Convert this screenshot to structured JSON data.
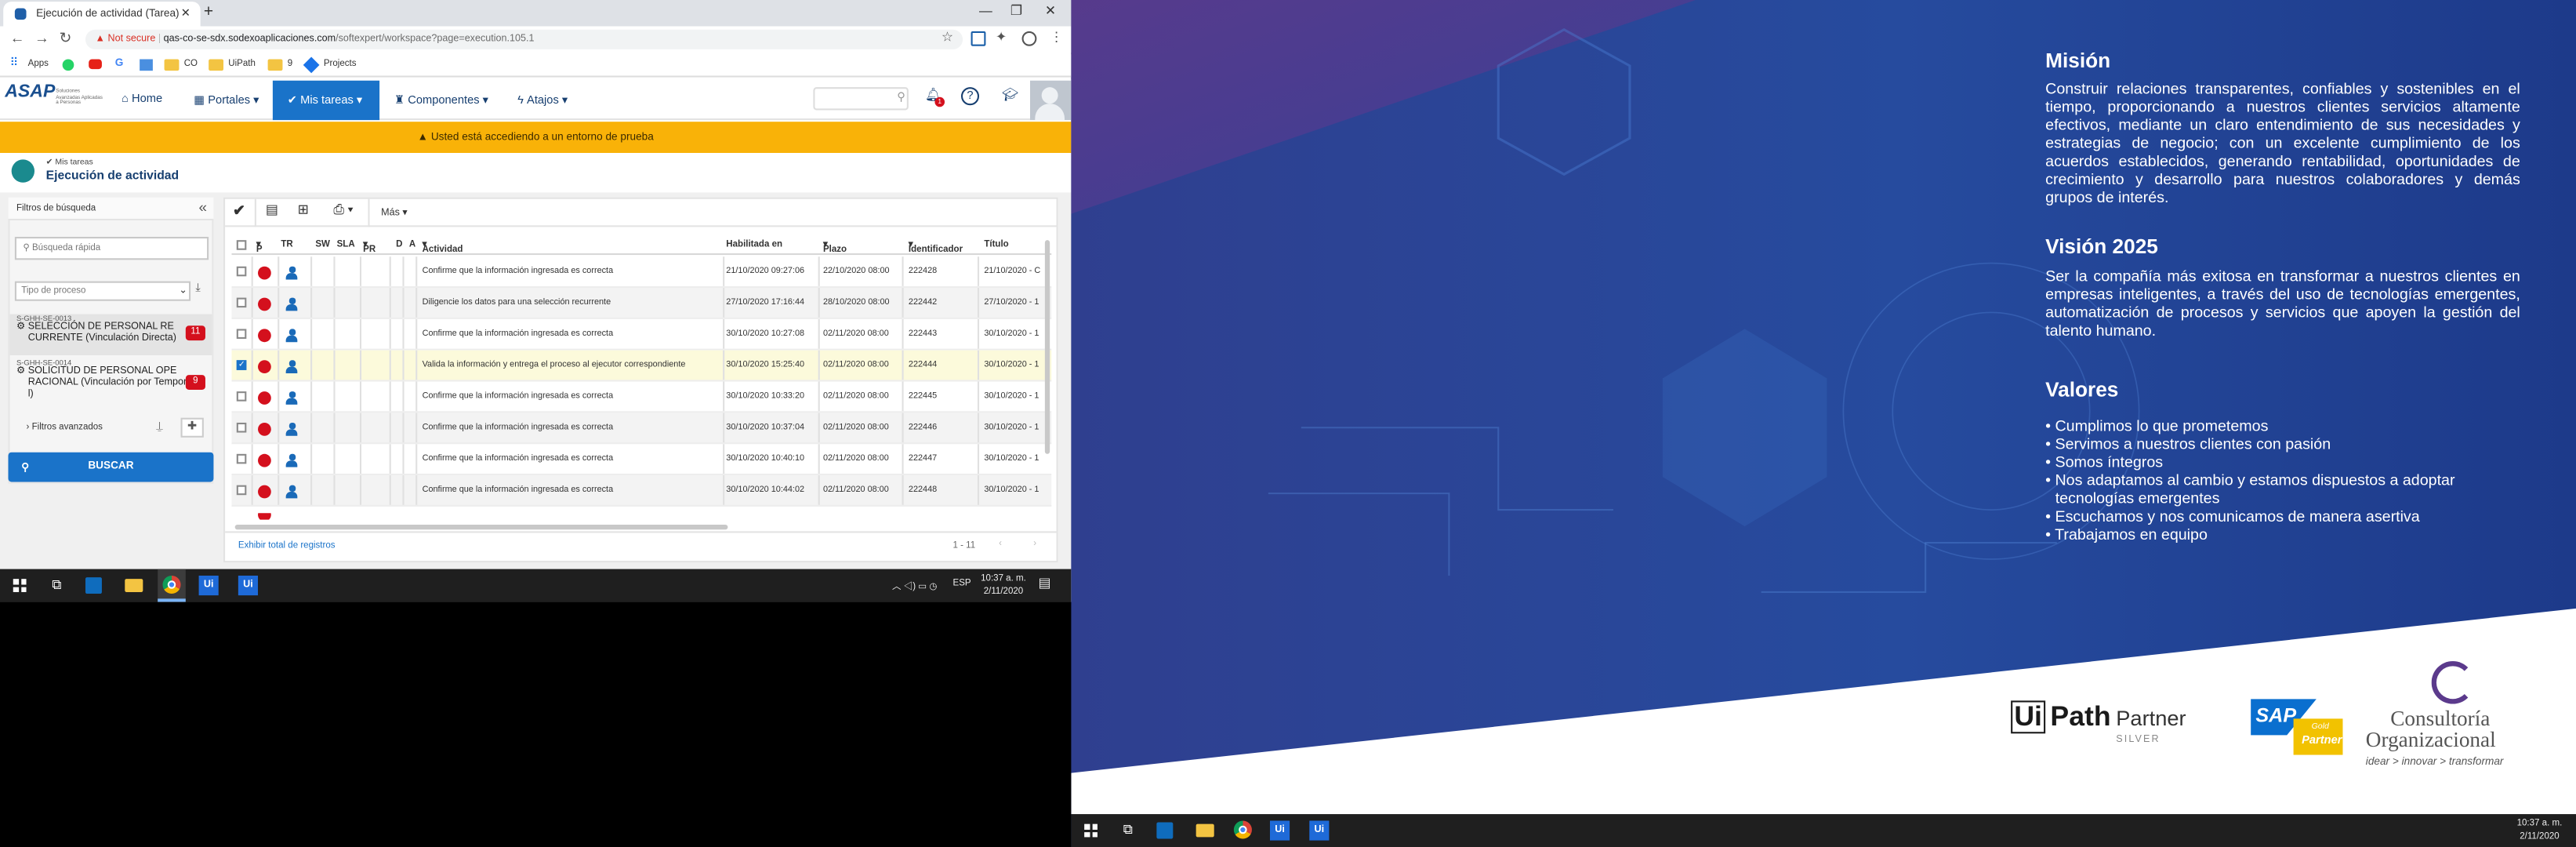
{
  "browser": {
    "tab_title": "Ejecución de actividad (Tarea)",
    "warning": "Not secure",
    "url_host": "qas-co-se-sdx.sodexoaplicaciones.com",
    "url_path": "/softexpert/workspace?page=execution.105.1",
    "bookmarks": [
      "Apps",
      "CO",
      "UiPath",
      "9",
      "Projects"
    ]
  },
  "header": {
    "logo": "ASAP",
    "logo_sub": "Soluciones Avanzadas Aplicadas a Personas",
    "menu": [
      "Home",
      "Portales",
      "Mis tareas",
      "Componentes",
      "Atajos"
    ],
    "notif_count": "1"
  },
  "banner": "Usted está accediendo a un entorno de prueba",
  "breadcrumb": {
    "parent": "Mis tareas",
    "title": "Ejecución de actividad"
  },
  "filters": {
    "title": "Filtros de búsqueda",
    "quick_placeholder": "Búsqueda rápida",
    "process_type": "Tipo de proceso",
    "items": [
      {
        "code": "S-GHH-SE-0013",
        "label": "SELECCIÓN DE PERSONAL RE CURRENTE (Vinculación Directa)",
        "count": "11"
      },
      {
        "code": "S-GHH-SE-0014",
        "label": "SOLICITUD DE PERSONAL OPE RACIONAL (Vinculación por Tempora l)",
        "count": "9"
      }
    ],
    "advanced": "Filtros avanzados",
    "search_button": "BUSCAR"
  },
  "toolbar": {
    "more": "Más"
  },
  "table": {
    "headers": [
      "P",
      "TR",
      "SW",
      "SLA",
      "PR",
      "D",
      "A",
      "Actividad",
      "Habilitada en",
      "Plazo",
      "Identificador",
      "Título"
    ],
    "rows": [
      {
        "actividad": "Confirme que la información ingresada es correcta",
        "habilitada": "21/10/2020 09:27:06",
        "plazo": "22/10/2020 08:00",
        "id": "222428",
        "titulo": "21/10/2020 - C",
        "checked": false
      },
      {
        "actividad": "Diligencie los datos para una selección recurrente",
        "habilitada": "27/10/2020 17:16:44",
        "plazo": "28/10/2020 08:00",
        "id": "222442",
        "titulo": "27/10/2020 - 1",
        "checked": false
      },
      {
        "actividad": "Confirme que la información ingresada es correcta",
        "habilitada": "30/10/2020 10:27:08",
        "plazo": "02/11/2020 08:00",
        "id": "222443",
        "titulo": "30/10/2020 - 1",
        "checked": false
      },
      {
        "actividad": "Valida la información y entrega el proceso al ejecutor correspondiente",
        "habilitada": "30/10/2020 15:25:40",
        "plazo": "02/11/2020 08:00",
        "id": "222444",
        "titulo": "30/10/2020 - 1",
        "checked": true
      },
      {
        "actividad": "Confirme que la información ingresada es correcta",
        "habilitada": "30/10/2020 10:33:20",
        "plazo": "02/11/2020 08:00",
        "id": "222445",
        "titulo": "30/10/2020 - 1",
        "checked": false
      },
      {
        "actividad": "Confirme que la información ingresada es correcta",
        "habilitada": "30/10/2020 10:37:04",
        "plazo": "02/11/2020 08:00",
        "id": "222446",
        "titulo": "30/10/2020 - 1",
        "checked": false
      },
      {
        "actividad": "Confirme que la información ingresada es correcta",
        "habilitada": "30/10/2020 10:40:10",
        "plazo": "02/11/2020 08:00",
        "id": "222447",
        "titulo": "30/10/2020 - 1",
        "checked": false
      },
      {
        "actividad": "Confirme que la información ingresada es correcta",
        "habilitada": "30/10/2020 10:44:02",
        "plazo": "02/11/2020 08:00",
        "id": "222448",
        "titulo": "30/10/2020 - 1",
        "checked": false
      }
    ],
    "footer_link": "Exhibir total de registros",
    "pagination": "1 - 11"
  },
  "taskbar": {
    "lang": "ESP",
    "time": "10:37 a. m.",
    "date": "2/11/2020"
  },
  "slide": {
    "mision_title": "Misión",
    "mision_text": "Construir relaciones transparentes, confiables y sostenibles en el tiempo, proporcionando a nuestros clientes servicios altamente efectivos, mediante un claro entendimiento de sus necesidades y estrategias de negocio; con un excelente cumplimiento de los acuerdos establecidos, generando rentabilidad, oportunidades de crecimiento y desarrollo para nuestros colaboradores y demás grupos de interés.",
    "vision_title": "Visión 2025",
    "vision_text": "Ser la compañía más exitosa en transformar a nuestros clientes en empresas inteligentes, a través del uso de tecnologías emergentes, automatización de procesos y servicios que apoyen la gestión del talento humano.",
    "valores_title": "Valores",
    "valores": [
      "Cumplimos lo que prometemos",
      "Servimos a nuestros clientes con pasión",
      "Somos íntegros",
      "Nos adaptamos al cambio y estamos dispuestos a adoptar tecnologías emergentes",
      "Escuchamos y nos comunicamos de manera asertiva",
      "Trabajamos en equipo"
    ],
    "uipath_ui": "Ui",
    "uipath_path": "Path",
    "uipath_partner": "Partner",
    "uipath_silver": "SILVER",
    "sap": "SAP",
    "sap_gold": "Gold",
    "sap_partner": "Partner",
    "co_name1": "Consultoría",
    "co_name2": "Organizacional",
    "co_tag": "idear > innovar > transformar"
  },
  "colors": {
    "accent": "#1a73c9",
    "banner": "#f9b208",
    "badge": "#d4101d",
    "slide_bg": "#243a8e"
  }
}
